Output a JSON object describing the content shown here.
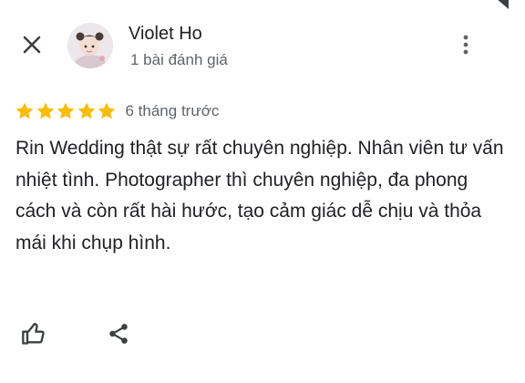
{
  "header": {
    "author_name": "Violet Ho",
    "review_count": "1 bài đánh giá",
    "icons": {
      "close": "close-icon",
      "more": "more-vert-icon",
      "avatar": "user-avatar"
    }
  },
  "review": {
    "rating": 5,
    "max_rating": 5,
    "time_ago": "6 tháng trước",
    "text": "Rin Wedding thật sự rất chuyên nghiệp. Nhân viên tư vấn nhiệt tình. Photographer thì chuyên nghiệp, đa phong cách và còn rất hài hước, tạo cảm giác dễ chịu và thỏa mái khi chụp hình."
  },
  "actions": {
    "icons": {
      "like": "thumb-up-icon",
      "share": "share-icon"
    }
  },
  "colors": {
    "star": "#fbbc04",
    "primary_text": "#202124",
    "secondary_text": "#5f6368",
    "icon": "#3c4043"
  }
}
